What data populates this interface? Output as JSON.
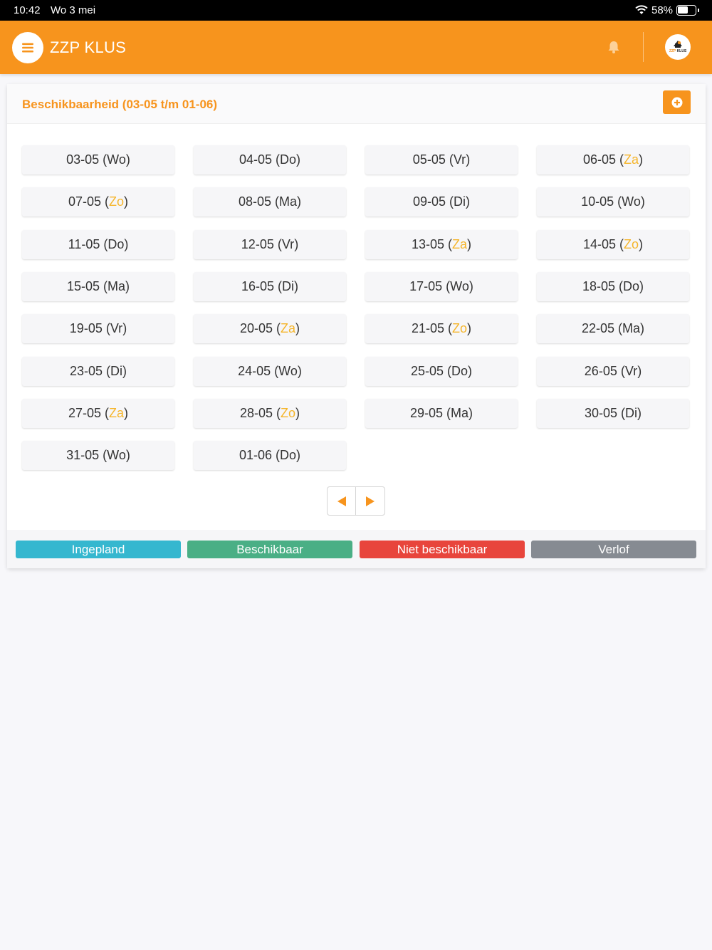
{
  "statusbar": {
    "time": "10:42",
    "date": "Wo 3 mei",
    "battery": "58%",
    "battery_level": 0.58
  },
  "appbar": {
    "title": "ZZP KLUS",
    "logo_text_1": "ZZP",
    "logo_text_2": "KLUS"
  },
  "card": {
    "title": "Beschikbaarheid (03-05 t/m 01-06)"
  },
  "days": [
    {
      "date": "03-05",
      "day": "Wo",
      "weekend": false
    },
    {
      "date": "04-05",
      "day": "Do",
      "weekend": false
    },
    {
      "date": "05-05",
      "day": "Vr",
      "weekend": false
    },
    {
      "date": "06-05",
      "day": "Za",
      "weekend": true
    },
    {
      "date": "07-05",
      "day": "Zo",
      "weekend": true
    },
    {
      "date": "08-05",
      "day": "Ma",
      "weekend": false
    },
    {
      "date": "09-05",
      "day": "Di",
      "weekend": false
    },
    {
      "date": "10-05",
      "day": "Wo",
      "weekend": false
    },
    {
      "date": "11-05",
      "day": "Do",
      "weekend": false
    },
    {
      "date": "12-05",
      "day": "Vr",
      "weekend": false
    },
    {
      "date": "13-05",
      "day": "Za",
      "weekend": true
    },
    {
      "date": "14-05",
      "day": "Zo",
      "weekend": true
    },
    {
      "date": "15-05",
      "day": "Ma",
      "weekend": false
    },
    {
      "date": "16-05",
      "day": "Di",
      "weekend": false
    },
    {
      "date": "17-05",
      "day": "Wo",
      "weekend": false
    },
    {
      "date": "18-05",
      "day": "Do",
      "weekend": false
    },
    {
      "date": "19-05",
      "day": "Vr",
      "weekend": false
    },
    {
      "date": "20-05",
      "day": "Za",
      "weekend": true
    },
    {
      "date": "21-05",
      "day": "Zo",
      "weekend": true
    },
    {
      "date": "22-05",
      "day": "Ma",
      "weekend": false
    },
    {
      "date": "23-05",
      "day": "Di",
      "weekend": false
    },
    {
      "date": "24-05",
      "day": "Wo",
      "weekend": false
    },
    {
      "date": "25-05",
      "day": "Do",
      "weekend": false
    },
    {
      "date": "26-05",
      "day": "Vr",
      "weekend": false
    },
    {
      "date": "27-05",
      "day": "Za",
      "weekend": true
    },
    {
      "date": "28-05",
      "day": "Zo",
      "weekend": true
    },
    {
      "date": "29-05",
      "day": "Ma",
      "weekend": false
    },
    {
      "date": "30-05",
      "day": "Di",
      "weekend": false
    },
    {
      "date": "31-05",
      "day": "Wo",
      "weekend": false
    },
    {
      "date": "01-06",
      "day": "Do",
      "weekend": false
    }
  ],
  "legend": [
    {
      "label": "Ingepland",
      "color": "#35b7cf"
    },
    {
      "label": "Beschikbaar",
      "color": "#4aaf85"
    },
    {
      "label": "Niet beschikbaar",
      "color": "#e8453c"
    },
    {
      "label": "Verlof",
      "color": "#868b92"
    }
  ],
  "colors": {
    "accent": "#f7941d",
    "weekend": "#f5b52a"
  },
  "icons": {
    "menu": "menu-icon",
    "bell": "bell-icon",
    "add": "plus-circle-icon",
    "prev": "caret-left-icon",
    "next": "caret-right-icon",
    "wifi": "wifi-icon",
    "battery": "battery-icon"
  }
}
